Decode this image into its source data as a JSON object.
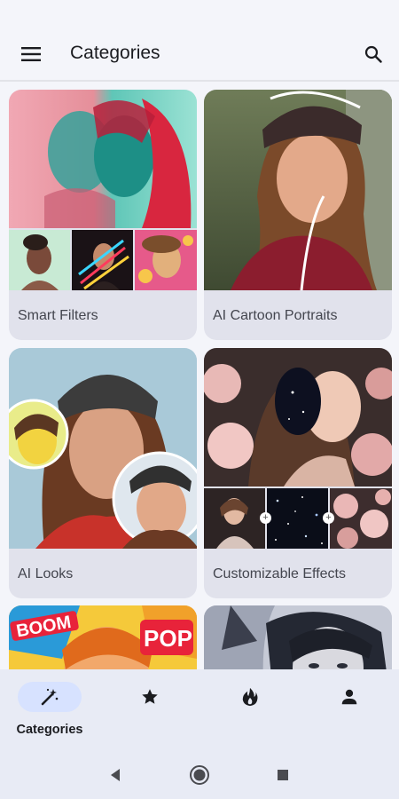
{
  "app_bar": {
    "title": "Categories"
  },
  "categories": [
    {
      "label": "Smart Filters"
    },
    {
      "label": "AI Cartoon Portraits"
    },
    {
      "label": "AI Looks"
    },
    {
      "label": "Customizable Effects"
    }
  ],
  "comic_card": {
    "text1": "BOOM",
    "text2": "POP"
  },
  "bottom_nav": [
    {
      "label": "Categories",
      "icon": "magic-wand-icon",
      "active": true
    },
    {
      "label": "",
      "icon": "star-icon",
      "active": false
    },
    {
      "label": "",
      "icon": "fire-icon",
      "active": false
    },
    {
      "label": "",
      "icon": "person-icon",
      "active": false
    }
  ],
  "colors": {
    "accent": "#d7e2ff",
    "background": "#f4f5fa",
    "card": "#e1e2ec"
  }
}
